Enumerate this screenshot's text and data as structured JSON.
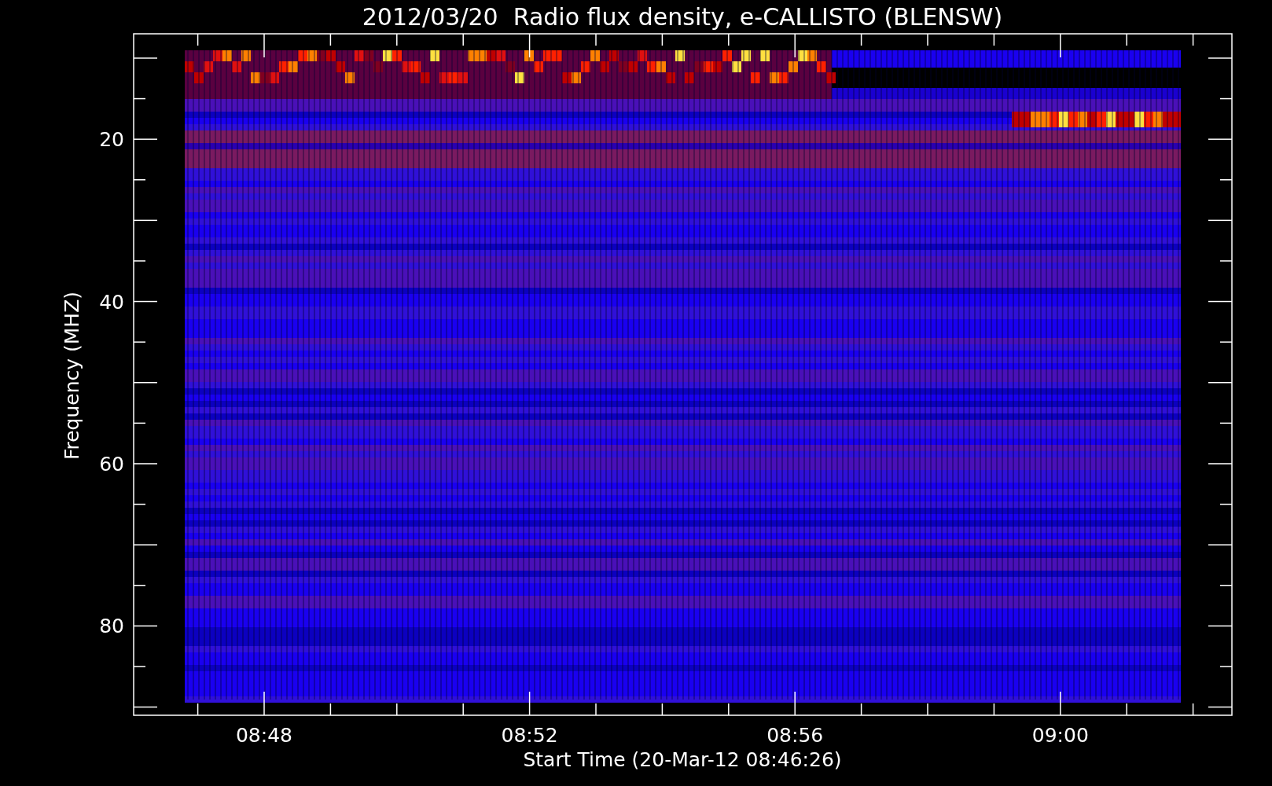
{
  "title": "2012/03/20  Radio flux density, e-CALLISTO (BLENSW)",
  "y_axis": {
    "label": "Frequency (MHZ)",
    "ticks": [
      "20",
      "40",
      "60",
      "80"
    ]
  },
  "x_axis": {
    "label": "Start Time (20-Mar-12 08:46:26)",
    "ticks": [
      "08:48",
      "08:52",
      "08:56",
      "09:00"
    ]
  }
}
